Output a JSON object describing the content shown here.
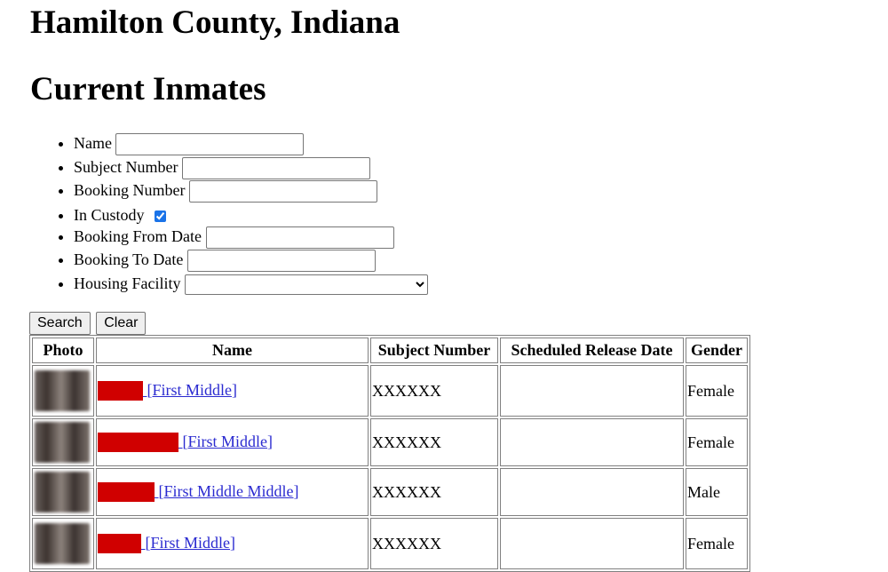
{
  "header": {
    "county_title": "Hamilton County, Indiana",
    "page_title": "Current Inmates"
  },
  "filters": {
    "name": {
      "label": "Name",
      "value": ""
    },
    "subject_number": {
      "label": "Subject Number",
      "value": ""
    },
    "booking_number": {
      "label": "Booking Number",
      "value": ""
    },
    "in_custody": {
      "label": "In Custody",
      "checked": true
    },
    "booking_from_date": {
      "label": "Booking From Date",
      "value": ""
    },
    "booking_to_date": {
      "label": "Booking To Date",
      "value": ""
    },
    "housing_facility": {
      "label": "Housing Facility",
      "selected": ""
    }
  },
  "buttons": {
    "search": "Search",
    "clear": "Clear"
  },
  "table": {
    "headers": [
      "Photo",
      "Name",
      "Subject Number",
      "Scheduled Release Date",
      "Gender"
    ],
    "rows": [
      {
        "photo": "blurred-photo",
        "name_redacted": true,
        "name": "[First Middle]",
        "subject_number": "XXXXXX",
        "release_date": "",
        "gender": "Female"
      },
      {
        "photo": "blurred-photo",
        "name_redacted": true,
        "name": "[First Middle]",
        "subject_number": "XXXXXX",
        "release_date": "",
        "gender": "Female"
      },
      {
        "photo": "blurred-photo",
        "name_redacted": true,
        "name": "[First Middle Middle]",
        "subject_number": "XXXXXX",
        "release_date": "",
        "gender": "Male"
      },
      {
        "photo": "blurred-photo",
        "name_redacted": true,
        "name": "[First Middle]",
        "subject_number": "XXXXXX",
        "release_date": "",
        "gender": "Female"
      }
    ]
  },
  "colors": {
    "redaction": "#d00000",
    "link": "#2a2ad0",
    "checkbox_accent": "#1a73e8"
  }
}
